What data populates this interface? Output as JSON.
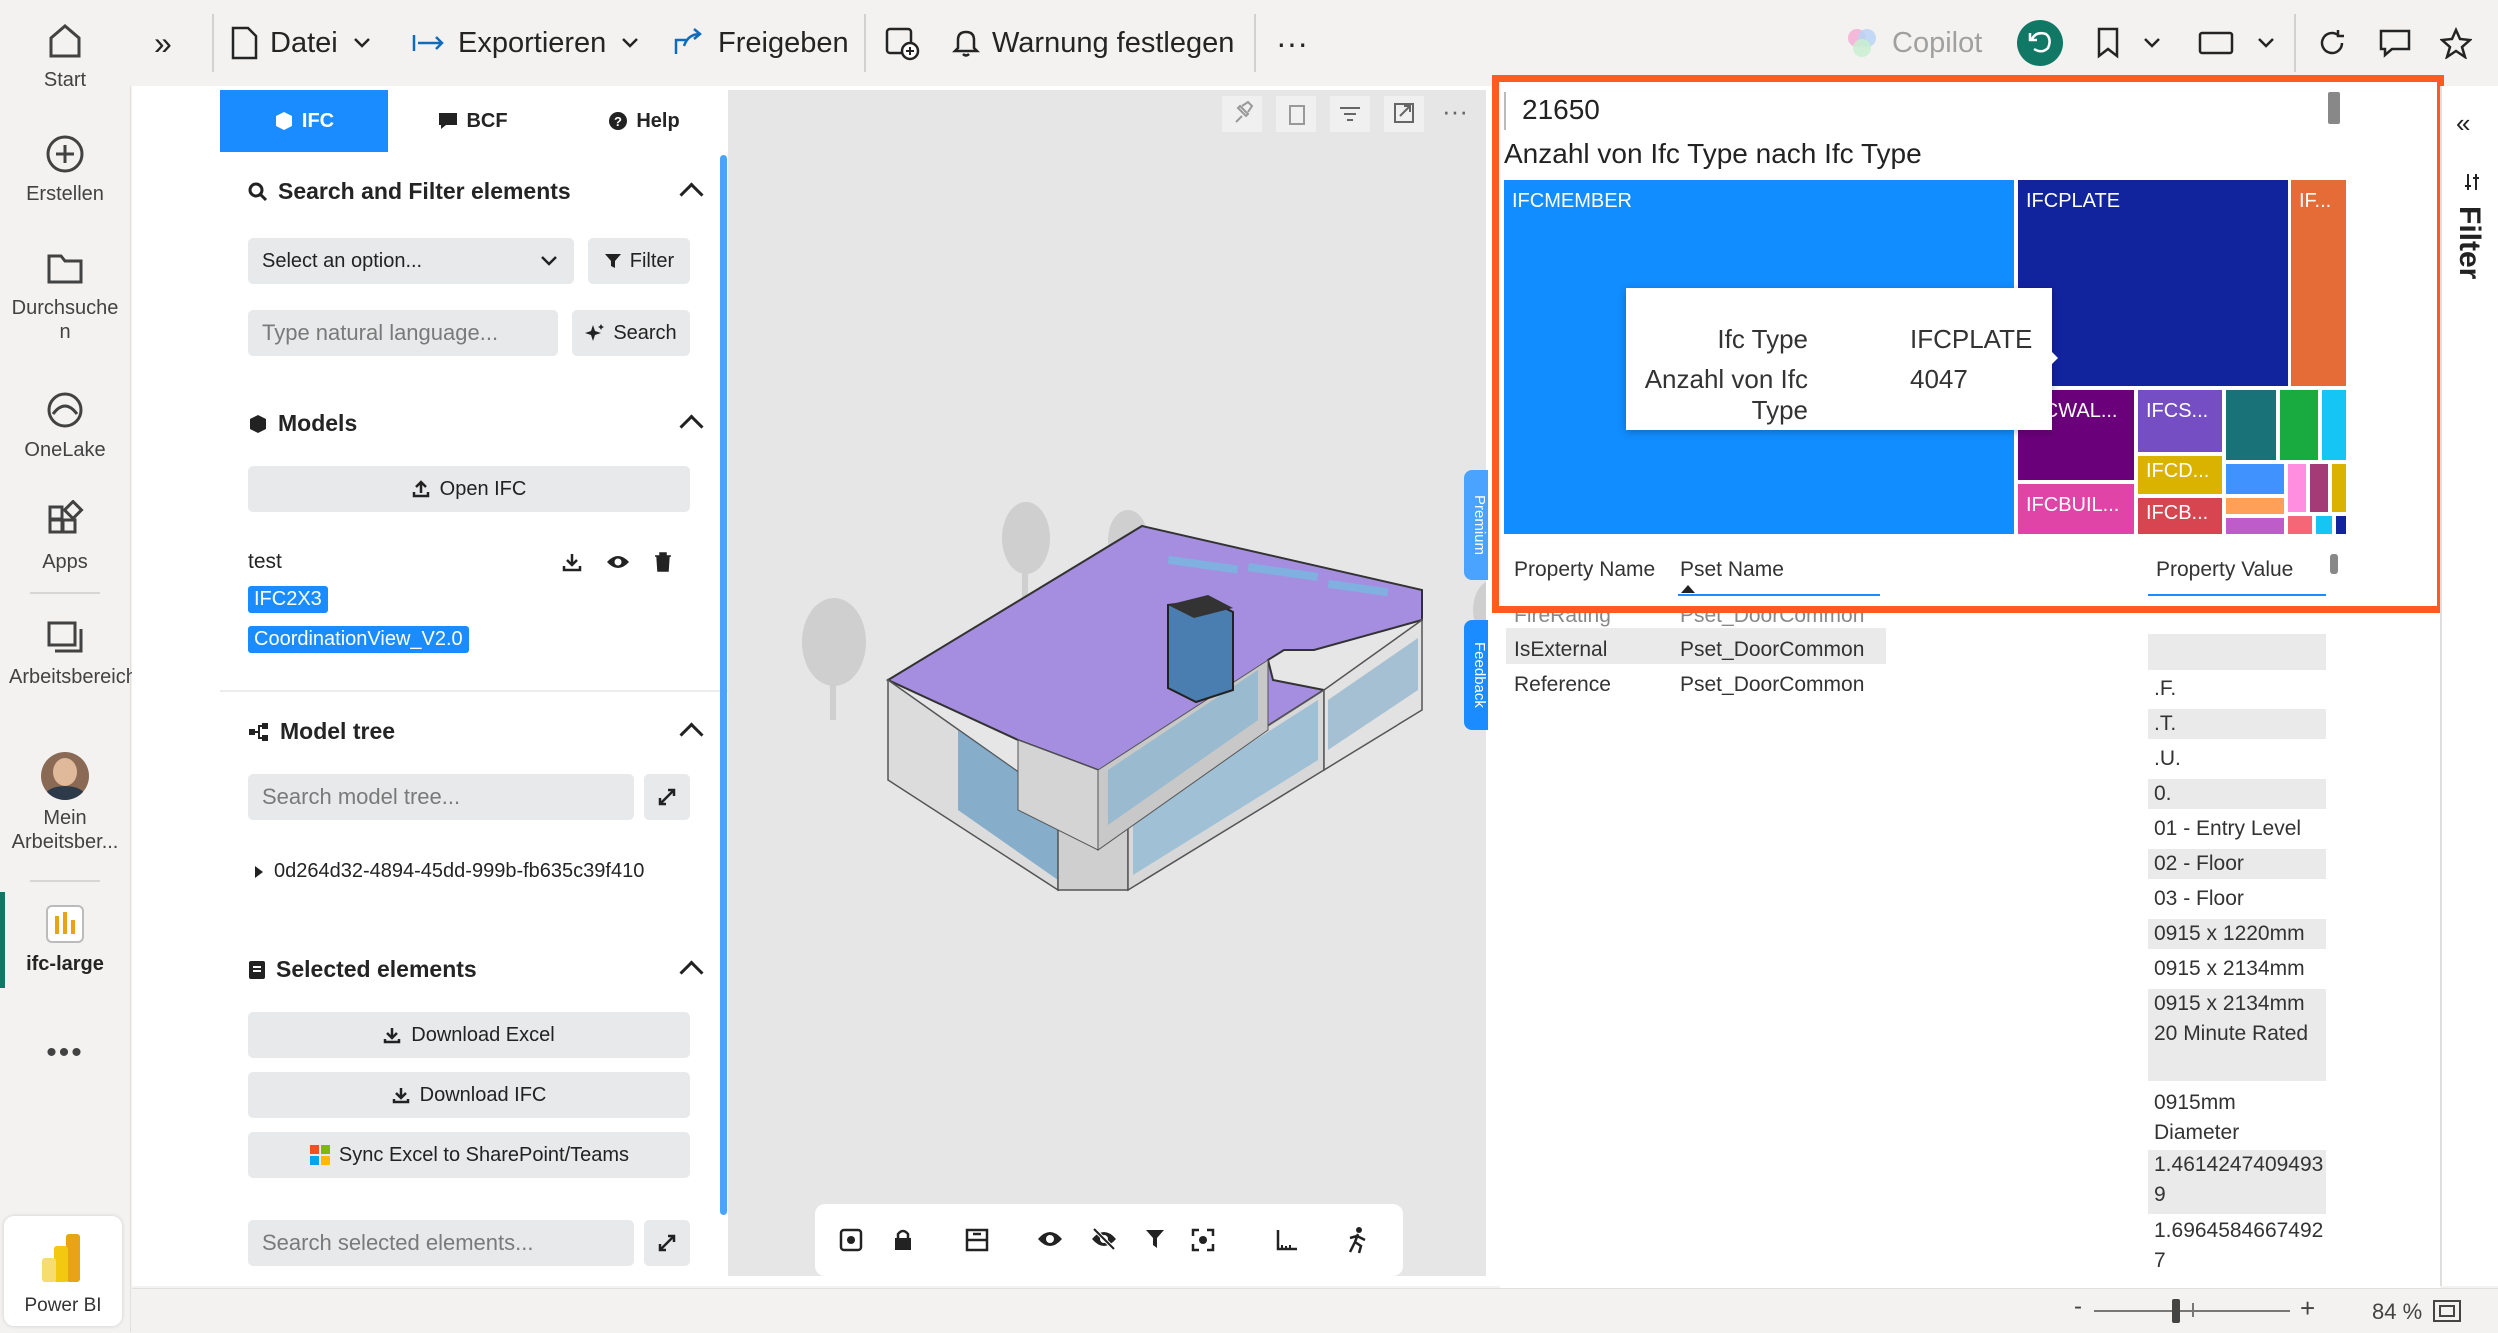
{
  "nav": {
    "items": [
      {
        "label": "Start",
        "icon": "home-icon"
      },
      {
        "label": "Erstellen",
        "icon": "plus-circle-icon"
      },
      {
        "label": "Durchsuchen",
        "icon": "folder-icon"
      },
      {
        "label": "OneLake",
        "icon": "onelake-icon"
      },
      {
        "label": "Apps",
        "icon": "apps-icon"
      },
      {
        "label": "Arbeitsbereiche",
        "icon": "workspaces-icon"
      },
      {
        "label": "Mein Arbeitsber...",
        "icon": "avatar"
      },
      {
        "label": "ifc-large",
        "icon": "report-icon"
      }
    ],
    "more": "•••",
    "product": "Power BI"
  },
  "toolbar": {
    "expand": "»",
    "file": "Datei",
    "export": "Exportieren",
    "share": "Freigeben",
    "alert": "Warnung festlegen",
    "more": "···",
    "copilot": "Copilot"
  },
  "ifc": {
    "tabs": [
      "IFC",
      "BCF",
      "Help"
    ],
    "search_filter": {
      "title": "Search and Filter elements",
      "select_placeholder": "Select an option...",
      "filter_label": "Filter",
      "nl_placeholder": "Type natural language...",
      "search_label": "Search"
    },
    "models": {
      "title": "Models",
      "open_label": "Open IFC",
      "model_name": "test",
      "badges": [
        "IFC2X3",
        "CoordinationView_V2.0"
      ]
    },
    "model_tree": {
      "title": "Model tree",
      "search_placeholder": "Search model tree...",
      "node": "0d264d32-4894-45dd-999b-fb635c39f410"
    },
    "selected": {
      "title": "Selected elements",
      "download_excel": "Download Excel",
      "download_ifc": "Download IFC",
      "sync": "Sync Excel to SharePoint/Teams",
      "search_placeholder": "Search selected elements..."
    }
  },
  "viewer": {
    "side_tabs": [
      "Premium",
      "Feedback"
    ]
  },
  "visual": {
    "card_value": "21650",
    "treemap_title": "Anzahl von Ifc Type nach Ifc Type",
    "treemap_tiles": [
      {
        "label": "IFCMEMBER",
        "color": "#118dff"
      },
      {
        "label": "IFCPLATE",
        "color": "#12239e"
      },
      {
        "label": "IF...",
        "color": "#e66c37"
      },
      {
        "label": "IFCWAL...",
        "color": "#6b007b"
      },
      {
        "label": "IFCS...",
        "color": "#744ec2"
      },
      {
        "label": "IFCD...",
        "color": "#d9b300"
      },
      {
        "label": "IFCBUIL...",
        "color": "#e044a7"
      },
      {
        "label": "IFCB...",
        "color": "#d64550"
      }
    ],
    "tooltip": {
      "k1": "Ifc Type",
      "v1": "IFCPLATE",
      "k2": "Anzahl von Ifc Type",
      "v2": "4047"
    },
    "table": {
      "headers": [
        "Property Name",
        "Pset Name",
        "Property Value"
      ],
      "rows": [
        {
          "name": "FireRating",
          "pset": "Pset_DoorCommon"
        },
        {
          "name": "IsExternal",
          "pset": "Pset_DoorCommon"
        },
        {
          "name": "Reference",
          "pset": "Pset_DoorCommon"
        }
      ],
      "values": [
        ".F.",
        ".T.",
        ".U.",
        "0.",
        "01 - Entry Level",
        "02 - Floor",
        "03 - Floor",
        "0915 x 1220mm",
        "0915 x 2134mm",
        "0915 x 2134mm 20 Minute Rated",
        "0915mm Diameter",
        "1.46142474094939",
        "1.69645846674927"
      ]
    }
  },
  "filter_pane": {
    "label": "Filter"
  },
  "status": {
    "zoom": "84 %",
    "minus": "-",
    "plus": "+"
  }
}
